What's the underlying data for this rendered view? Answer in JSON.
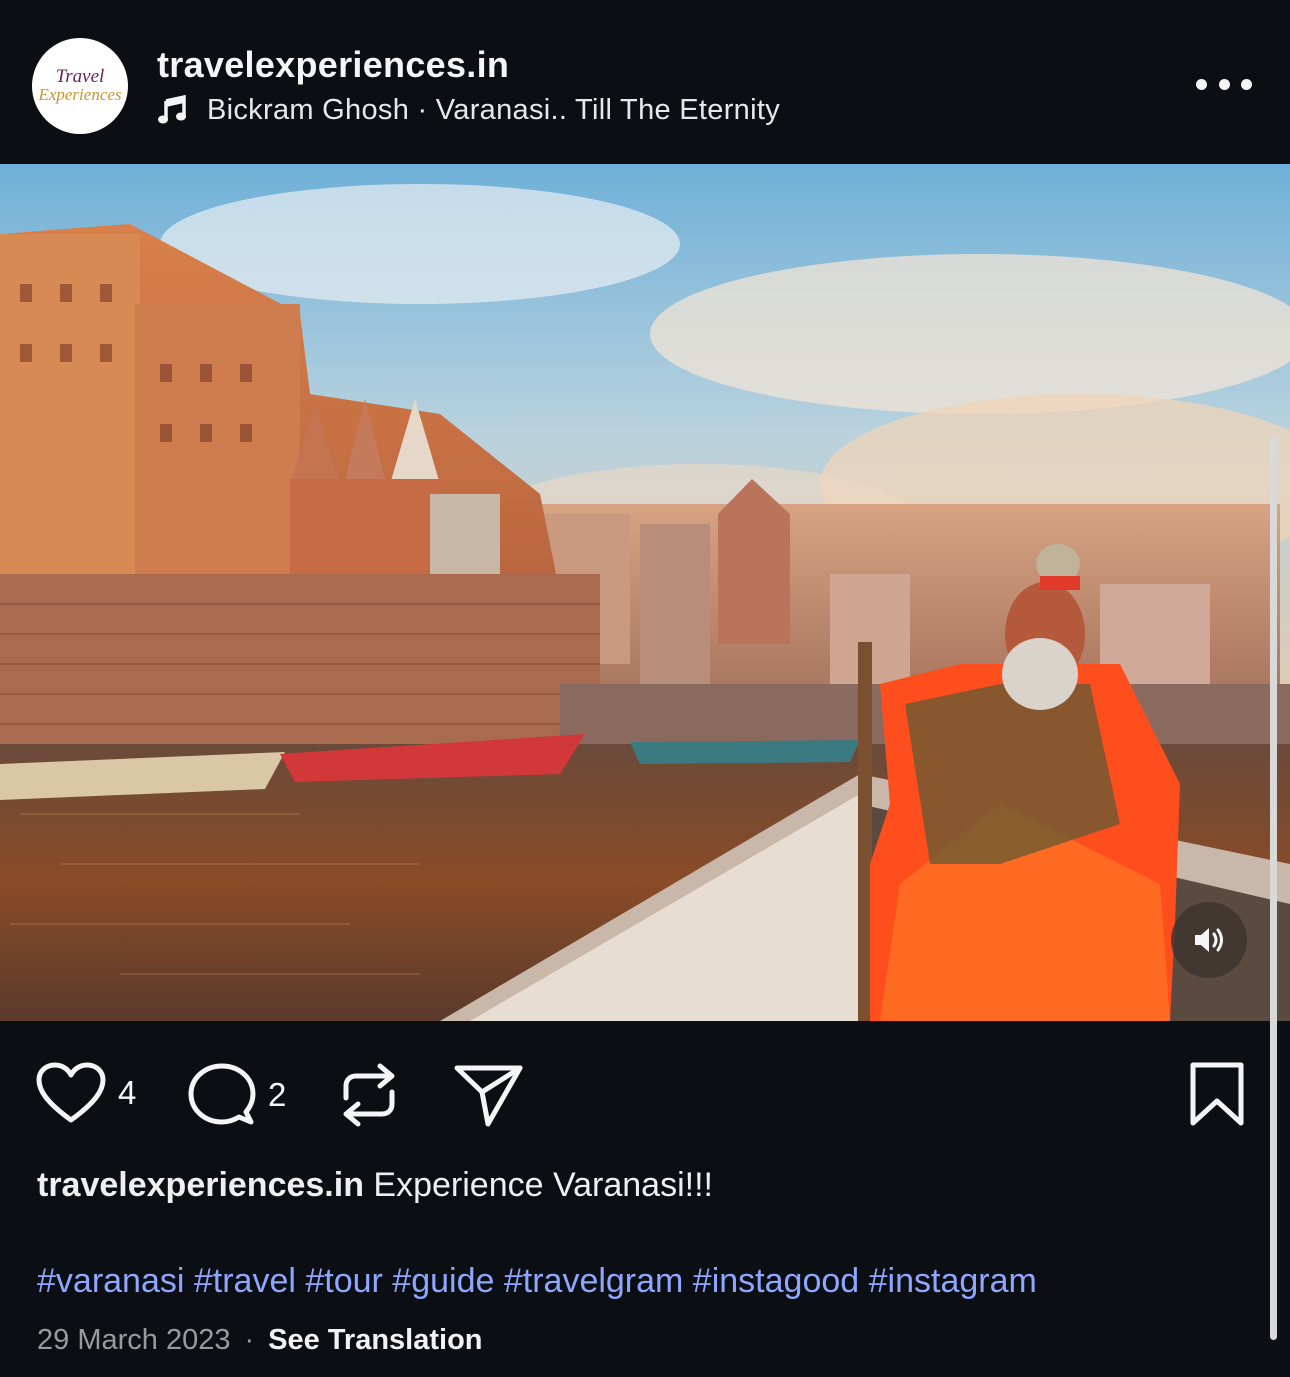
{
  "post": {
    "username": "travelexperiences.in",
    "avatar": {
      "line1": "Travel",
      "line2": "Experiences"
    },
    "audio": "Bickram Ghosh · Varanasi.. Till The Eternity"
  },
  "actions": {
    "likes": "4",
    "comments": "2"
  },
  "caption": {
    "username": "travelexperiences.in",
    "text": " Experience Varanasi!!!"
  },
  "hashtags": "#varanasi #travel #tour #guide #travelgram #instagood #instagram",
  "date": "29 March 2023",
  "separator": "·",
  "see_translation": "See Translation",
  "colors": {
    "background": "#0b0f14",
    "hashtag": "#8fa6ff",
    "text": "#f5f5f5"
  },
  "icons": [
    "music-note-icon",
    "more-options-icon",
    "heart-icon",
    "comment-icon",
    "repost-icon",
    "share-icon",
    "bookmark-icon",
    "volume-icon"
  ]
}
